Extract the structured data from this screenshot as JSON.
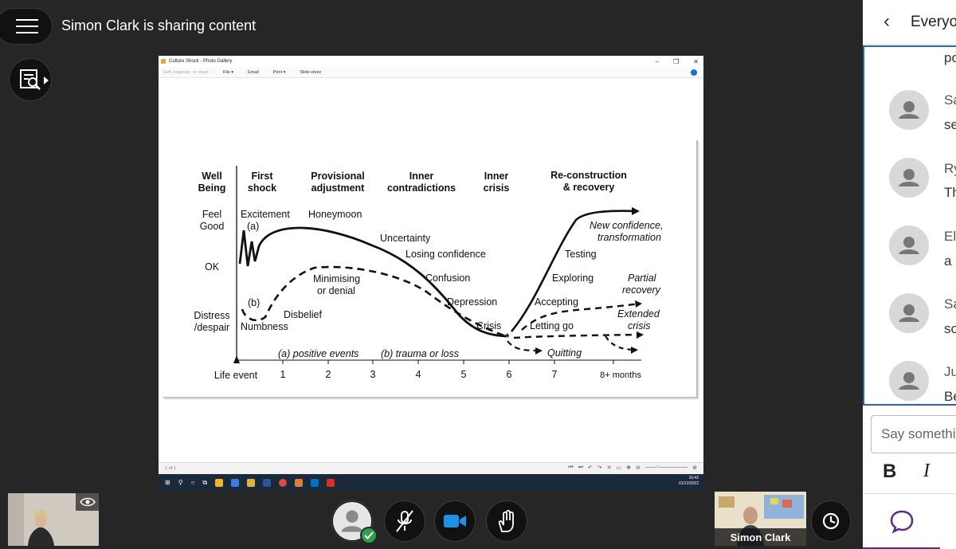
{
  "header": {
    "sharing_text": "Simon Clark is sharing content",
    "menu_icon": "hamburger-icon",
    "content_icon": "search-document-icon"
  },
  "photo_gallery": {
    "title": "Culture Shock - Photo Gallery",
    "menu": {
      "edit": "Edit, organize, or share",
      "file": "File ▾",
      "email": "Email",
      "print": "Print ▾",
      "slideshow": "Slide show"
    },
    "status": "1 of 1",
    "clock_time": "16:42",
    "clock_date": "01/12/2022"
  },
  "chart": {
    "phases": [
      {
        "l1": "Well",
        "l2": "Being"
      },
      {
        "l1": "First",
        "l2": "shock"
      },
      {
        "l1": "Provisional",
        "l2": "adjustment"
      },
      {
        "l1": "Inner",
        "l2": "contradictions"
      },
      {
        "l1": "Inner",
        "l2": "crisis"
      },
      {
        "l1": "Re-construction",
        "l2": "& recovery"
      }
    ],
    "y_levels": {
      "feel_good_1": "Feel",
      "feel_good_2": "Good",
      "ok": "OK",
      "distress_1": "Distress",
      "distress_2": "/despair"
    },
    "labels": {
      "excitement": "Excitement",
      "a": "(a)",
      "honeymoon": "Honeymoon",
      "uncertainty": "Uncertainty",
      "losing_confidence": "Losing confidence",
      "confusion": "Confusion",
      "depression": "Depression",
      "crisis": "Crisis",
      "minimising_1": "Minimising",
      "minimising_2": "or denial",
      "b": "(b)",
      "disbelief": "Disbelief",
      "numbness": "Numbness",
      "new_conf_1": "New confidence,",
      "new_conf_2": "transformation",
      "testing": "Testing",
      "exploring": "Exploring",
      "accepting": "Accepting",
      "letting_go": "Letting go",
      "partial_1": "Partial",
      "partial_2": "recovery",
      "extended_1": "Extended",
      "extended_2": "crisis",
      "quitting": "Quitting",
      "legend_a": "(a) positive events",
      "legend_b": "(b) trauma or loss"
    },
    "x_axis": {
      "start": "Life event",
      "ticks": [
        "1",
        "2",
        "3",
        "4",
        "5",
        "6",
        "7",
        "8+ months"
      ]
    }
  },
  "side_panel": {
    "title": "Everyone",
    "messages": [
      {
        "name": "",
        "text": "po"
      },
      {
        "name": "Sa",
        "text": "se"
      },
      {
        "name": "Ry",
        "text": "Th"
      },
      {
        "name": "El",
        "text": "a p"
      },
      {
        "name": "Sa",
        "text": "so"
      },
      {
        "name": "Ju",
        "text": "Be"
      }
    ],
    "input_placeholder": "Say something",
    "bold": "B",
    "italic": "I"
  },
  "bottom": {
    "presenter_name": "Simon Clark",
    "controls": [
      "avatar-icon",
      "microphone-off-icon",
      "camera-icon",
      "raise-hand-icon"
    ]
  },
  "colors": {
    "background": "#262626",
    "accent_blue": "#2a66a8",
    "chat_purple": "#5e2a84",
    "status_green": "#2e9e4f",
    "camera_blue": "#1e90e8"
  }
}
